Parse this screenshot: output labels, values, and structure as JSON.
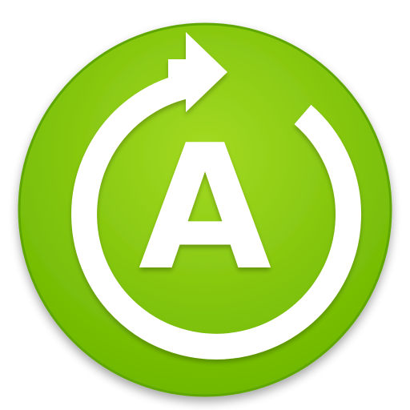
{
  "icon": {
    "semantic": "refresh-letter-icon",
    "letter": "A"
  },
  "colors": {
    "background": "#ffffff",
    "badge_top": "#a3da22",
    "badge_bottom": "#6fb800",
    "badge_rim": "#5fa600",
    "glyph": "#ffffff"
  }
}
